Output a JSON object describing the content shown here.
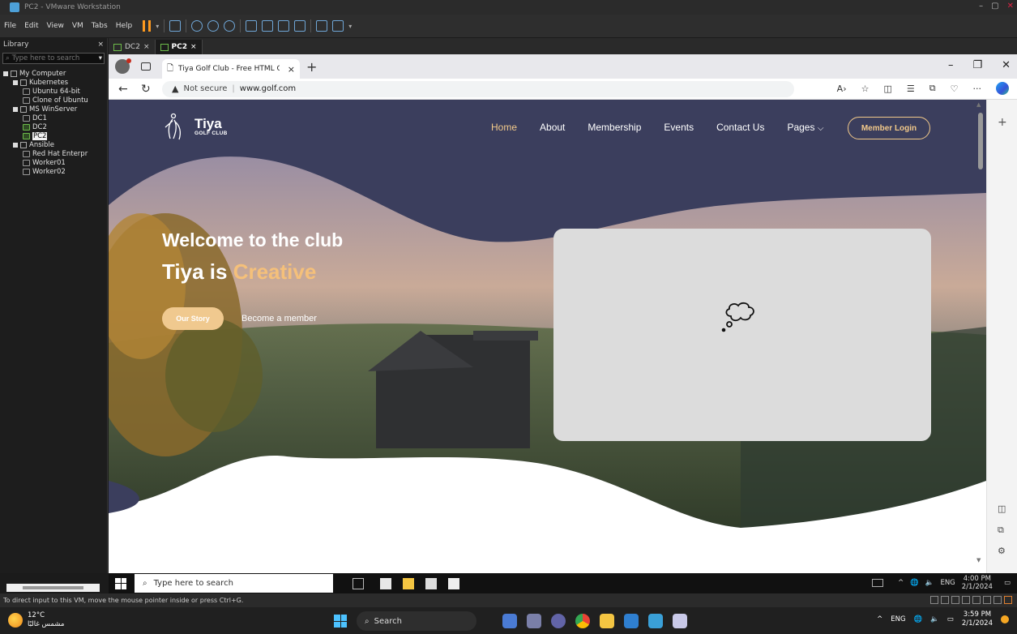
{
  "vmware": {
    "title": "PC2 - VMware Workstation",
    "menu": [
      "File",
      "Edit",
      "View",
      "VM",
      "Tabs",
      "Help"
    ],
    "library": {
      "title": "Library",
      "search_placeholder": "Type here to search",
      "tree": [
        {
          "label": "My Computer",
          "level": 0,
          "kind": "folder"
        },
        {
          "label": "Kubernetes",
          "level": 1,
          "kind": "folder"
        },
        {
          "label": "Ubuntu 64-bit",
          "level": 2,
          "kind": "vm"
        },
        {
          "label": "Clone of Ubuntu",
          "level": 2,
          "kind": "vm"
        },
        {
          "label": "MS WinServer",
          "level": 1,
          "kind": "folder"
        },
        {
          "label": "DC1",
          "level": 2,
          "kind": "vm"
        },
        {
          "label": "DC2",
          "level": 2,
          "kind": "vm-on"
        },
        {
          "label": "PC2",
          "level": 2,
          "kind": "vm-on",
          "selected": true
        },
        {
          "label": "Ansible",
          "level": 1,
          "kind": "folder"
        },
        {
          "label": "Red Hat Enterpr",
          "level": 2,
          "kind": "vm"
        },
        {
          "label": "Worker01",
          "level": 2,
          "kind": "vm"
        },
        {
          "label": "Worker02",
          "level": 2,
          "kind": "vm"
        }
      ]
    },
    "tabs": [
      {
        "label": "DC2",
        "active": false
      },
      {
        "label": "PC2",
        "active": true
      }
    ],
    "status_text": "To direct input to this VM, move the mouse pointer inside or press Ctrl+G."
  },
  "browser": {
    "tab_title": "Tiya Golf Club - Free HTML CSS T",
    "security_label": "Not secure",
    "url": "www.golf.com"
  },
  "site": {
    "brand": "Tiya",
    "brand_sub": "GOLF CLUB",
    "nav": [
      "Home",
      "About",
      "Membership",
      "Events",
      "Contact Us",
      "Pages"
    ],
    "login_label": "Member Login",
    "headline": "Welcome to the club",
    "tagline_prefix": "Tiya is ",
    "tagline_accent": "Creative",
    "story_button": "Our Story",
    "member_link": "Become a member"
  },
  "guest_taskbar": {
    "search_placeholder": "Type here to search",
    "lang": "ENG",
    "time": "4:00 PM",
    "date": "2/1/2024"
  },
  "host_taskbar": {
    "temperature": "12°C",
    "weather_text": "مشمس غالبًا",
    "search_label": "Search",
    "lang": "ENG",
    "time": "3:59 PM",
    "date": "2/1/2024"
  },
  "colors": {
    "accent_gold": "#f2c98a",
    "hero_navy": "#3a3d5c"
  }
}
